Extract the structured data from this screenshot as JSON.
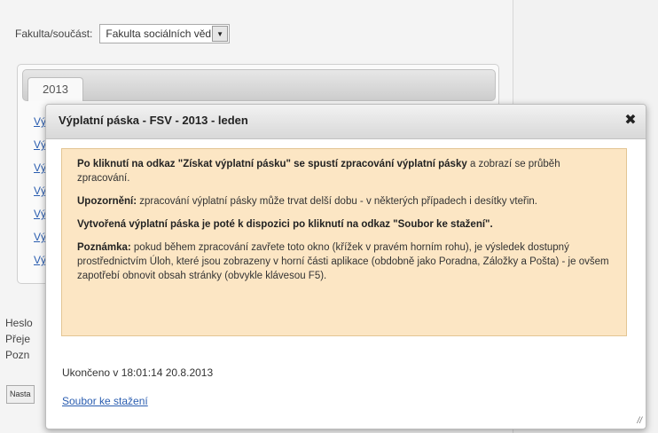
{
  "faculty": {
    "label": "Fakulta/součást:",
    "selected": "Fakulta sociálních věd"
  },
  "tabs": [
    {
      "label": "2013"
    }
  ],
  "year_links": [
    "Vý",
    "Vý",
    "Vý",
    "Vý",
    "Vý",
    "Vý",
    "Vý"
  ],
  "left_side": {
    "line1": "Heslo",
    "line2": "Přeje",
    "line3": "Pozn",
    "button": "Nasta"
  },
  "dialog": {
    "title": "Výplatní páska - FSV - 2013 - leden",
    "close_glyph": "✖",
    "info": {
      "p1_bold": "Po kliknutí na odkaz \"Získat výplatní pásku\" se spustí zpracování výplatní pásky",
      "p1_rest": " a zobrazí se průběh zpracování.",
      "p2_bold": "Upozornění:",
      "p2_rest": " zpracování výplatní pásky může trvat delší dobu - v některých případech i desítky vteřin.",
      "p3_bold": "Vytvořená výplatní páska je poté k dispozici po kliknutí na odkaz \"Soubor ke stažení\".",
      "p4_bold": "Poznámka:",
      "p4_rest": " pokud během zpracování zavřete toto okno (křížek v pravém horním rohu), je výsledek dostupný prostřednictvím Úloh, které jsou zobrazeny v horní části aplikace (obdobně jako Poradna, Záložky a Pošta) - je ovšem zapotřebí obnovit obsah stránky (obvykle klávesou F5)."
    },
    "status": "Ukončeno v 18:01:14 20.8.2013",
    "download_link": "Soubor ke stažení"
  },
  "colors": {
    "info_bg": "#fce6c4",
    "info_border": "#e3c593",
    "link": "#2a5db0"
  }
}
